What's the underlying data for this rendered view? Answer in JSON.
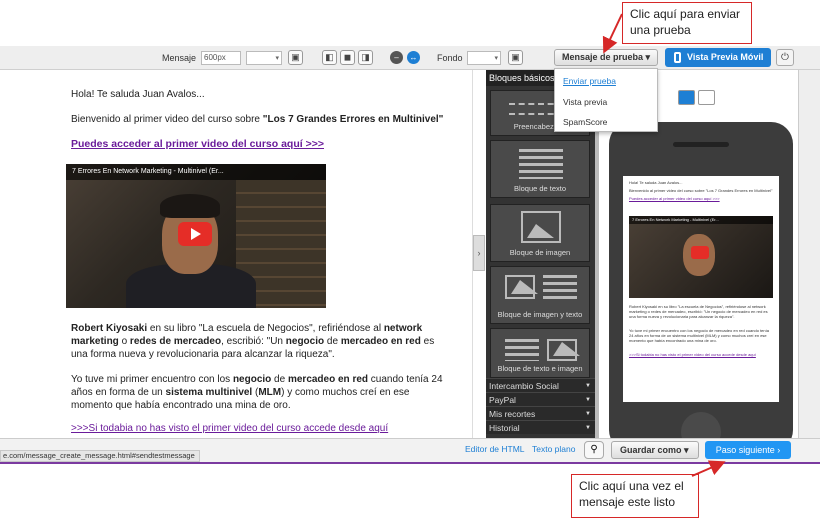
{
  "toolbar": {
    "message_label": "Mensaje",
    "width_value": "600px",
    "background_label": "Fondo",
    "test_message_label": "Mensaje de prueba",
    "mobile_preview_label": "Vista Previa Móvil"
  },
  "dropdown": {
    "items": [
      "Enviar prueba",
      "Vista previa",
      "SpamScore"
    ]
  },
  "email": {
    "greeting": "Hola! Te saluda Juan Avalos...",
    "welcome_prefix": "Bienvenido al primer video del curso sobre ",
    "welcome_course": "\"Los 7 Grandes Errores en Multinivel\"",
    "access_link": "Puedes acceder al primer video del curso aquí >>>",
    "video_title": "7 Errores En Network Marketing - Multinivel (Er...",
    "p1_author": "Robert Kiyosaki",
    "p1_a": " en su libro \"La escuela de Negocios\", refiriéndose  al ",
    "p1_b": "network marketing",
    "p1_c": " o ",
    "p1_d": "redes de mercadeo",
    "p1_e": ", escribió: \"Un ",
    "p1_f": "negocio",
    "p1_g": " de ",
    "p1_h": "mercadeo en red",
    "p1_i": " es una forma nueva y revolucionaria para alcanzar la riqueza\".",
    "p2_a": "Yo tuve mi primer encuentro con los ",
    "p2_b": "negocio",
    "p2_c": " de ",
    "p2_d": "mercadeo en red",
    "p2_e": " cuando tenía 24 años en forma de un ",
    "p2_f": "sistema multinivel",
    "p2_g": " (",
    "p2_h": "MLM",
    "p2_i": ") y como muchos creí en ese momento que había encontrado una mina de oro.",
    "bottom_link": ">>>Si todabia no has visto el primer video del curso accede desde aquí"
  },
  "blocks": {
    "header": "Bloques básicos",
    "tiles": [
      "Preencabezado",
      "Bloque de texto",
      "Bloque de imagen",
      "Bloque de imagen y texto",
      "Bloque de texto e imagen"
    ],
    "categories": [
      "Intercambio Social",
      "PayPal",
      "Mis recortes",
      "Historial"
    ]
  },
  "bottom": {
    "status_url": "e.com/message_create_message.html#sendtestmessage",
    "html_editor": "Editor de HTML",
    "plain_text": "Texto plano",
    "save_label": "Guardar como",
    "next_label": "Paso siguiente"
  },
  "callouts": {
    "top": "Clic aquí para enviar una prueba",
    "bottom": "Clic aquí una vez el mensaje este listo"
  },
  "icons": {
    "dropdown_caret": "▾",
    "next_caret": "›",
    "collapse": "›",
    "paperclip": "⚲",
    "power": "⏻"
  },
  "colors": {
    "primary_button": "#1e7fd4",
    "next_button": "#2196f3",
    "callout_border": "#d62828",
    "link_purple": "#6a1b9a",
    "blocks_panel": "#333333"
  }
}
